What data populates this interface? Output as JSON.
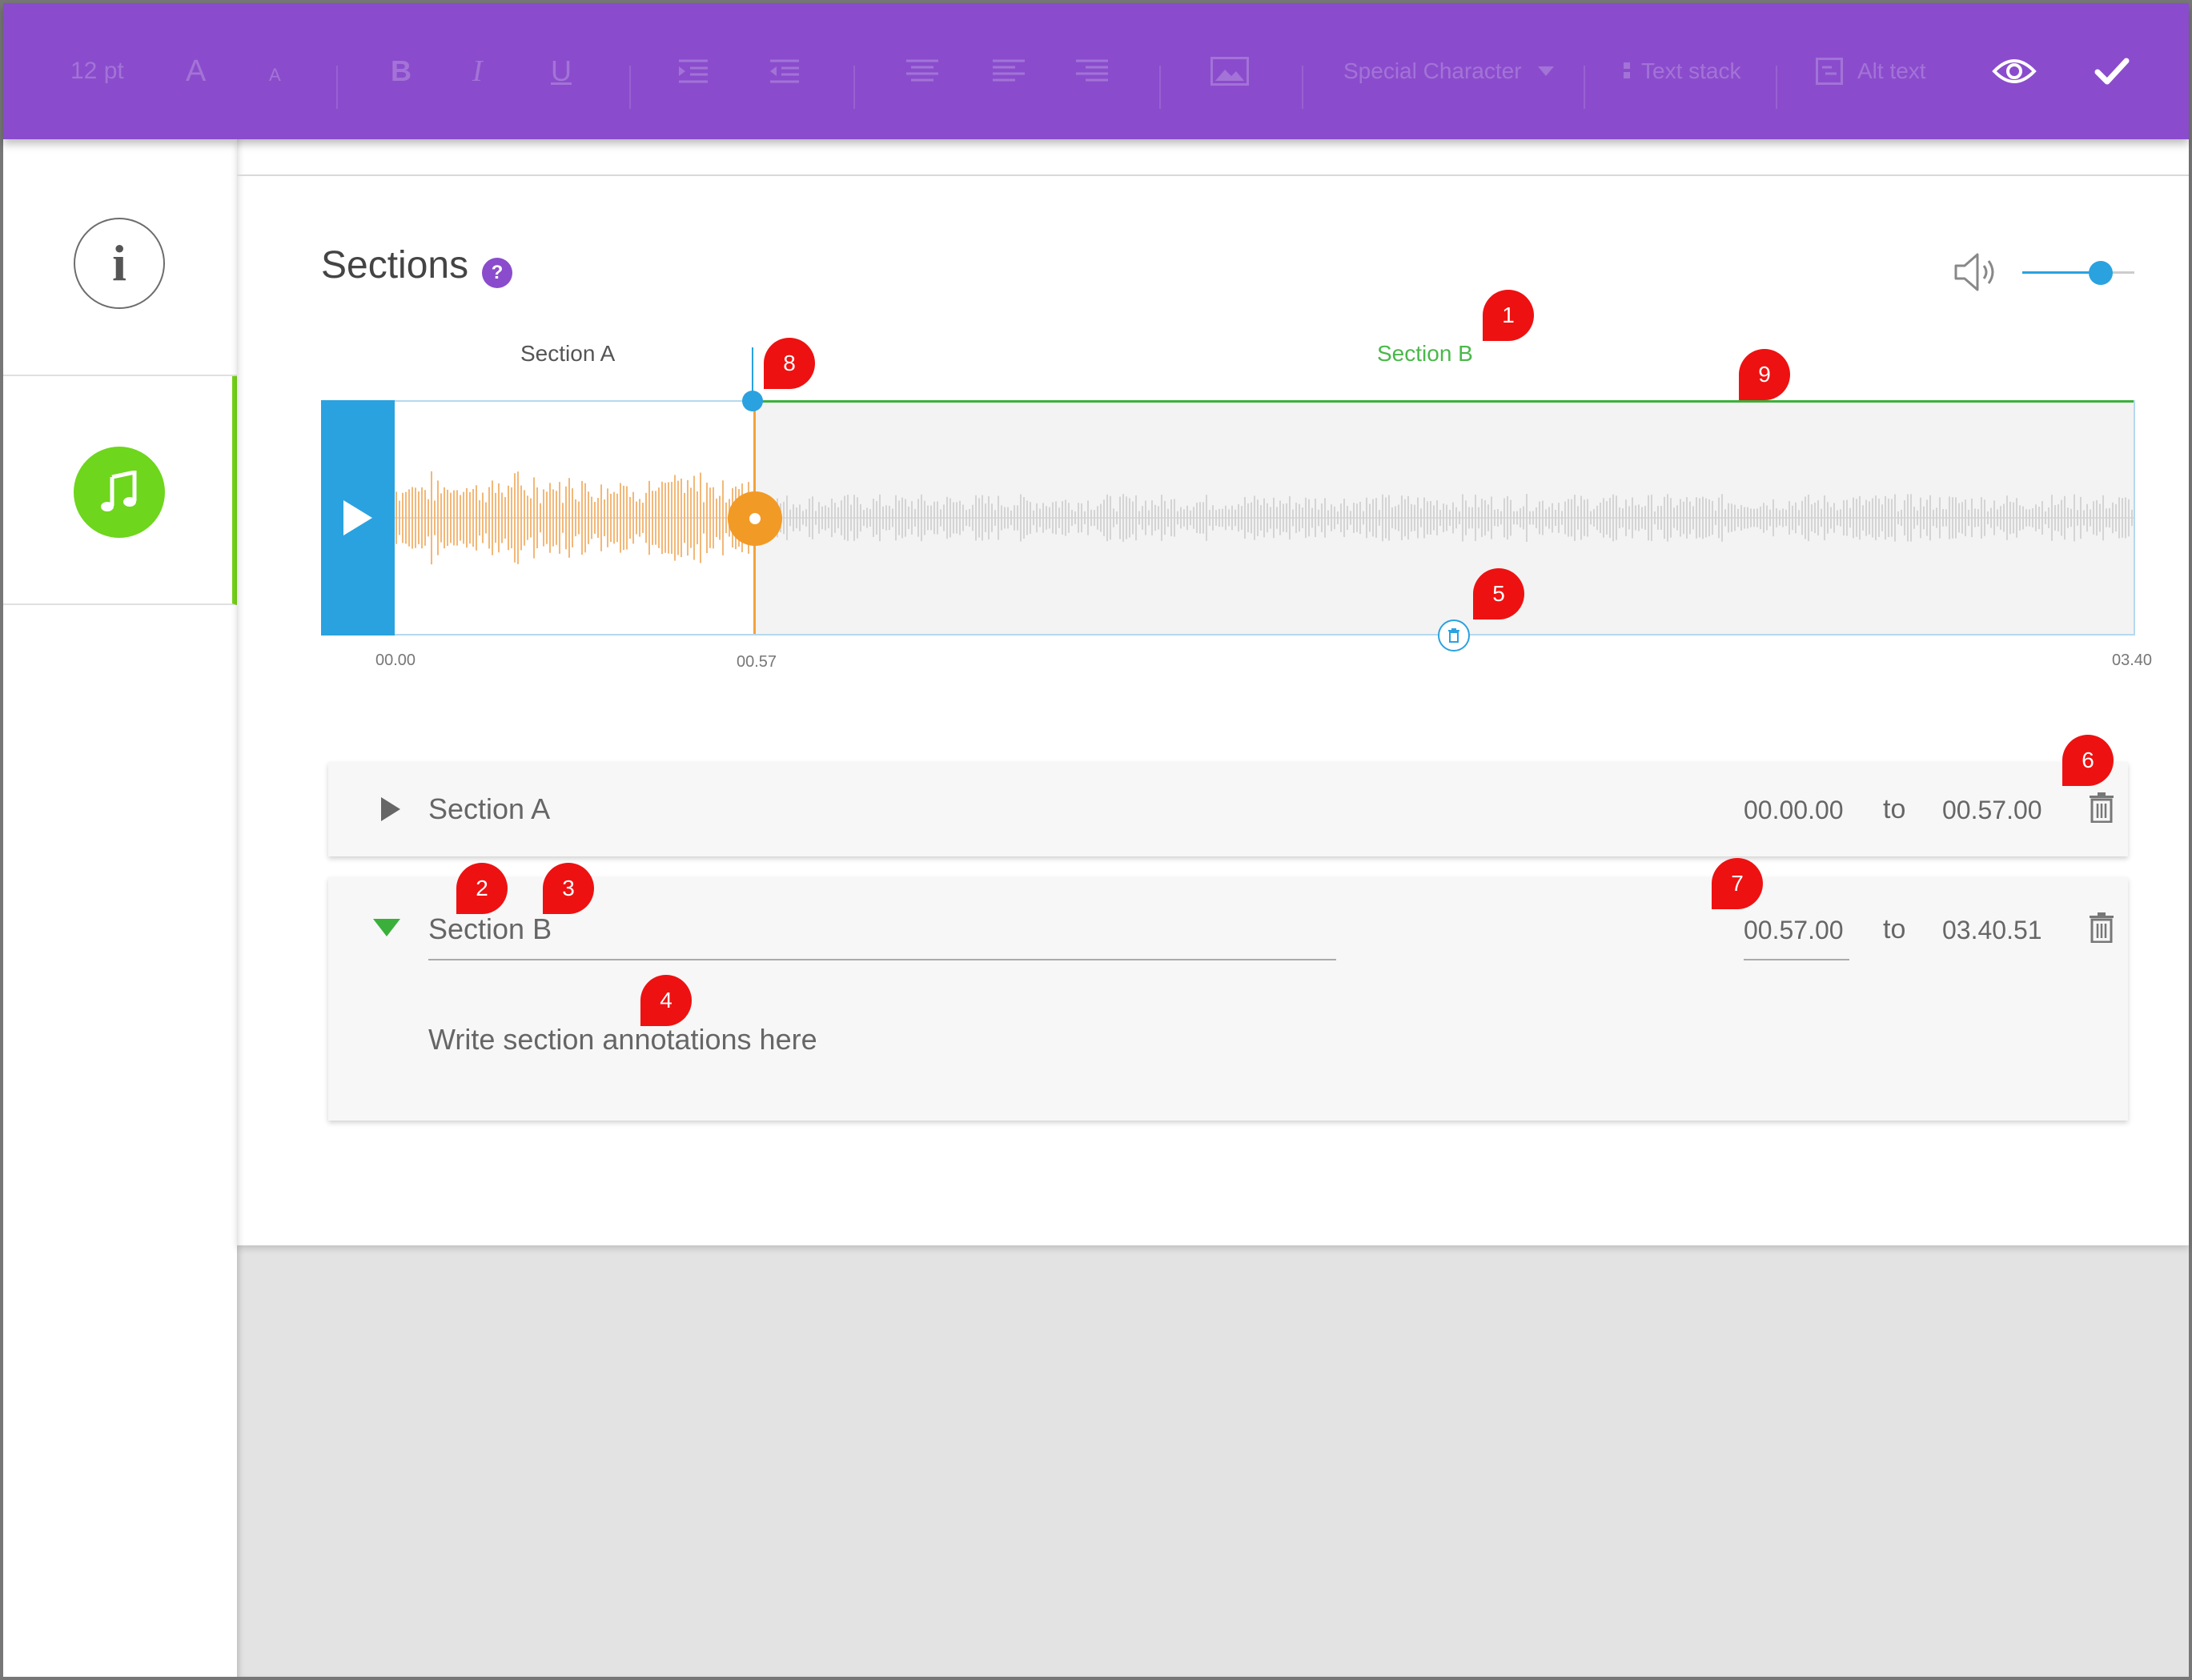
{
  "toolbar": {
    "font_size": "12 pt",
    "font_large": "A",
    "font_small": "A",
    "bold": "B",
    "italic": "I",
    "underline": "U",
    "special_character": "Special Character",
    "text_stack": "Text stack",
    "alt_text": "Alt text",
    "icons": [
      "indent-increase-icon",
      "indent-decrease-icon",
      "align-center-icon",
      "align-left-icon",
      "align-right-icon",
      "image-icon",
      "preview-eye-icon",
      "confirm-check-icon"
    ]
  },
  "sidebar": {
    "items": [
      {
        "name": "info",
        "icon": "info-icon"
      },
      {
        "name": "audio",
        "icon": "music-note-icon",
        "active": true
      }
    ],
    "info_glyph": "i"
  },
  "main": {
    "title": "Sections",
    "help_glyph": "?",
    "volume_level": 0.7
  },
  "timeline": {
    "section_a_label": "Section A",
    "section_b_label": "Section B",
    "time_start": "00.00",
    "time_mid": "00.57",
    "time_end": "03.40",
    "split_fraction": 0.259
  },
  "sections": [
    {
      "name": "Section A",
      "from": "00.00.00",
      "to_word": "to",
      "to": "00.57.00",
      "expanded": false
    },
    {
      "name": "Section B",
      "from": "00.57.00",
      "to_word": "to",
      "to": "03.40.51",
      "expanded": true,
      "annotation_placeholder": "Write section annotations here"
    }
  ],
  "markers": [
    "1",
    "2",
    "3",
    "4",
    "5",
    "6",
    "7",
    "8",
    "9"
  ],
  "colors": {
    "toolbar": "#8a4ccc",
    "accent_blue": "#2aa2e0",
    "section_b_green": "#4ab84a",
    "playhead_orange": "#f29a26",
    "marker_red": "#ee1111"
  }
}
